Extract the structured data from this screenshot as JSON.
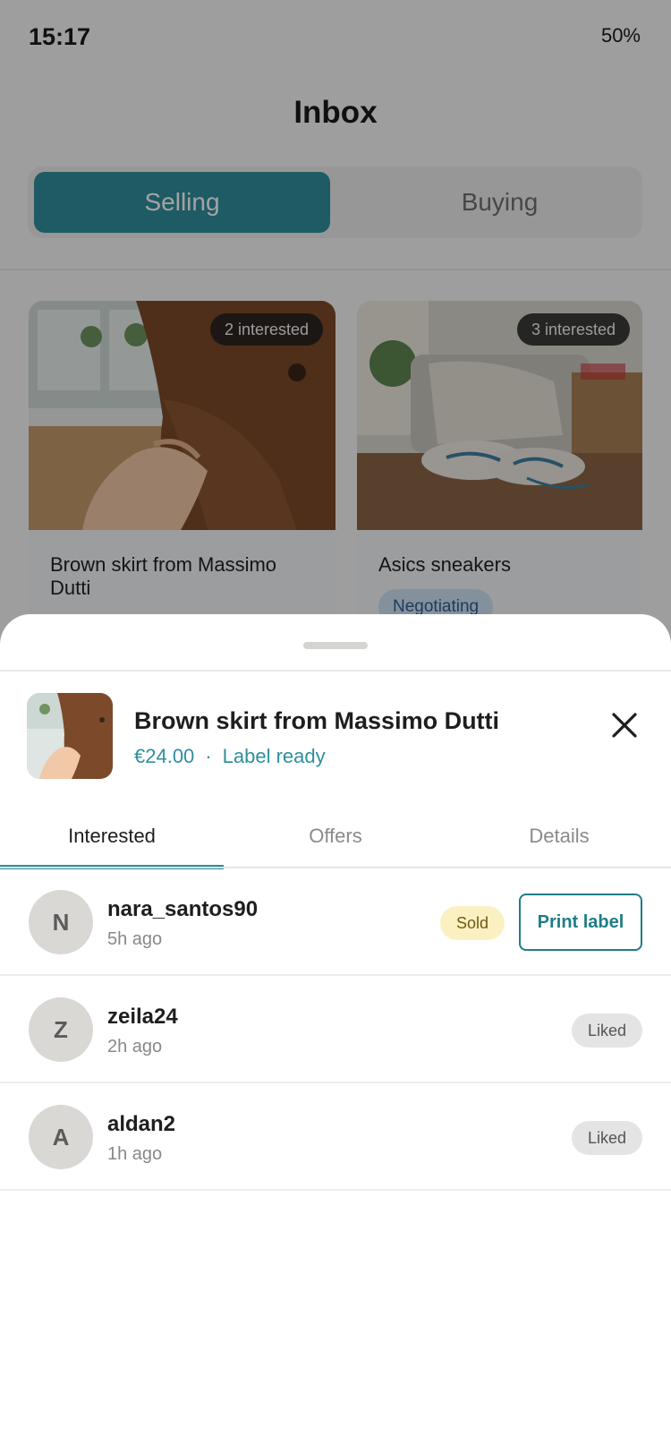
{
  "status_bar": {
    "time": "15:17",
    "battery": "50%"
  },
  "header": {
    "title": "Inbox"
  },
  "segmented": {
    "selling": "Selling",
    "buying": "Buying"
  },
  "listings": [
    {
      "title": "Brown skirt from Massimo Dutti",
      "interested": "2 interested"
    },
    {
      "title": "Asics sneakers",
      "interested": "3 interested",
      "status": "Negotiating"
    }
  ],
  "sheet": {
    "item_title": "Brown skirt from Massimo Dutti",
    "price": "€24.00",
    "separator": "·",
    "status": "Label ready",
    "tabs": [
      "Interested",
      "Offers",
      "Details"
    ],
    "active_tab": "Interested",
    "rows": [
      {
        "initial": "N",
        "username": "nara_santos90",
        "time": "5h ago",
        "badge": "Sold",
        "action": "Print label"
      },
      {
        "initial": "Z",
        "username": "zeila24",
        "time": "2h ago",
        "badge": "Liked"
      },
      {
        "initial": "A",
        "username": "aldan2",
        "time": "1h ago",
        "badge": "Liked"
      }
    ]
  },
  "colors": {
    "accent": "#2f8f9d",
    "sold_bg": "#fbf0c1",
    "liked_bg": "#e4e4e4",
    "negotiating_bg": "#cfe2f5"
  }
}
